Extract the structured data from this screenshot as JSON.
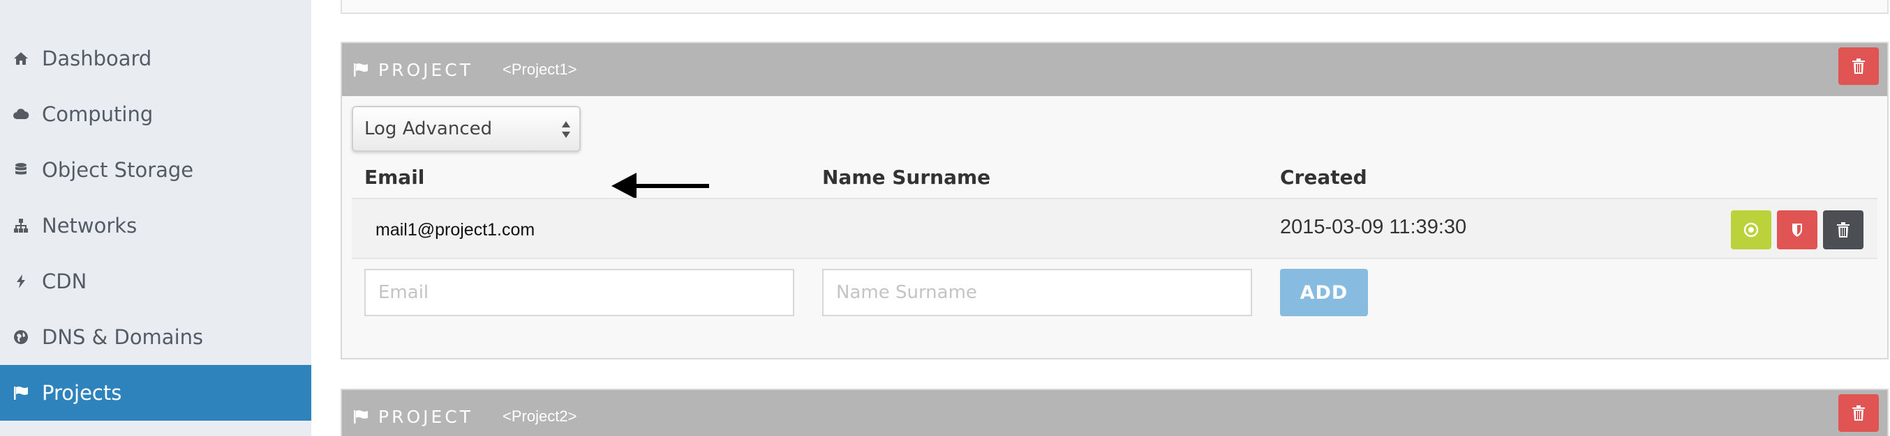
{
  "sidebar": {
    "items": [
      {
        "label": "Dashboard",
        "icon": "home-icon",
        "active": false
      },
      {
        "label": "Computing",
        "icon": "cloud-icon",
        "active": false
      },
      {
        "label": "Object Storage",
        "icon": "database-icon",
        "active": false
      },
      {
        "label": "Networks",
        "icon": "sitemap-icon",
        "active": false
      },
      {
        "label": "CDN",
        "icon": "bolt-icon",
        "active": false
      },
      {
        "label": "DNS & Domains",
        "icon": "globe-icon",
        "active": false
      },
      {
        "label": "Projects",
        "icon": "flag-icon",
        "active": true
      }
    ]
  },
  "projects": [
    {
      "header_label": "PROJECT",
      "name": "<Project1>",
      "log_select": {
        "selected": "Log Advanced"
      },
      "columns": {
        "email": "Email",
        "name": "Name Surname",
        "created": "Created"
      },
      "members": [
        {
          "email": "mail1@project1.com",
          "name": "",
          "created": "2015-03-09 11:39:30"
        }
      ],
      "new_member": {
        "email_placeholder": "Email",
        "name_placeholder": "Name Surname",
        "add_label": "ADD"
      }
    },
    {
      "header_label": "PROJECT",
      "name": "<Project2>"
    }
  ],
  "colors": {
    "sidebar_bg": "#e9edf2",
    "active": "#2f83bd",
    "panel_header": "#b5b5b5",
    "danger": "#e15454",
    "success": "#bcd23a",
    "dark": "#4b4f54",
    "add_button": "#87bbe0"
  }
}
